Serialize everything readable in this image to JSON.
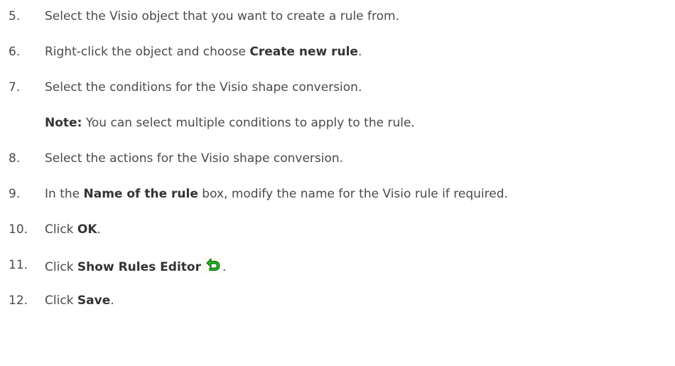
{
  "steps": [
    {
      "num": "5.",
      "text": "Select the Visio object that you want to create a rule from."
    },
    {
      "num": "6.",
      "pre": "Right-click the object and choose ",
      "bold": "Create new rule",
      "post": "."
    },
    {
      "num": "7.",
      "text": "Select the conditions for the Visio shape conversion."
    },
    {
      "note_label": "Note:",
      "note_text": " You can select multiple conditions to apply to the rule."
    },
    {
      "num": "8.",
      "text": "Select the actions for the Visio shape conversion."
    },
    {
      "num": "9.",
      "pre": "In the ",
      "bold": "Name of the rule",
      "post": " box, modify the name for the Visio rule if required."
    },
    {
      "num": "10.",
      "pre": "Click ",
      "bold": "OK",
      "post": "."
    },
    {
      "num": "11.",
      "pre": "Click ",
      "bold": "Show Rules Editor",
      "post": "."
    },
    {
      "num": "12.",
      "pre": "Click ",
      "bold": "Save",
      "post": "."
    }
  ],
  "icons": {
    "show_rules_editor": "green-return-arrow-icon",
    "accent_color": "#22b422"
  }
}
